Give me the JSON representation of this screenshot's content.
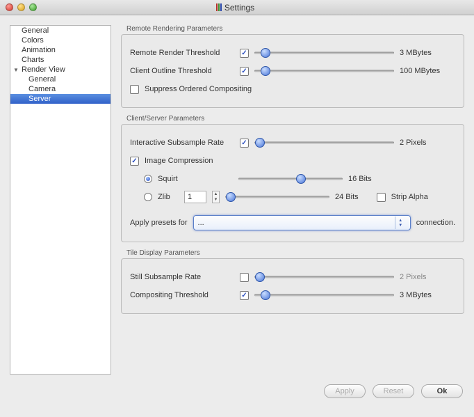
{
  "window": {
    "title": "Settings"
  },
  "sidebar": {
    "items": [
      {
        "label": "General"
      },
      {
        "label": "Colors"
      },
      {
        "label": "Animation"
      },
      {
        "label": "Charts"
      },
      {
        "label": "Render View",
        "expanded": true
      },
      {
        "label": "General"
      },
      {
        "label": "Camera"
      },
      {
        "label": "Server",
        "selected": true
      }
    ]
  },
  "groups": {
    "remote": {
      "title": "Remote Rendering Parameters",
      "remote_render_label": "Remote Render Threshold",
      "remote_render_value": "3 MBytes",
      "client_outline_label": "Client Outline Threshold",
      "client_outline_value": "100 MBytes",
      "suppress_label": "Suppress Ordered Compositing"
    },
    "client_server": {
      "title": "Client/Server Parameters",
      "subsample_label": "Interactive Subsample Rate",
      "subsample_value": "2 Pixels",
      "compress_label": "Image Compression",
      "squirt_label": "Squirt",
      "squirt_value": "16 Bits",
      "zlib_label": "Zlib",
      "zlib_num": "1",
      "zlib_value": "24 Bits",
      "strip_alpha_label": "Strip Alpha",
      "preset_prefix": "Apply presets for",
      "preset_selected": "...",
      "preset_suffix": "connection."
    },
    "tile": {
      "title": "Tile Display Parameters",
      "still_label": "Still Subsample Rate",
      "still_value": "2 Pixels",
      "composite_label": "Compositing Threshold",
      "composite_value": "3 MBytes"
    }
  },
  "buttons": {
    "apply": "Apply",
    "reset": "Reset",
    "ok": "Ok"
  }
}
